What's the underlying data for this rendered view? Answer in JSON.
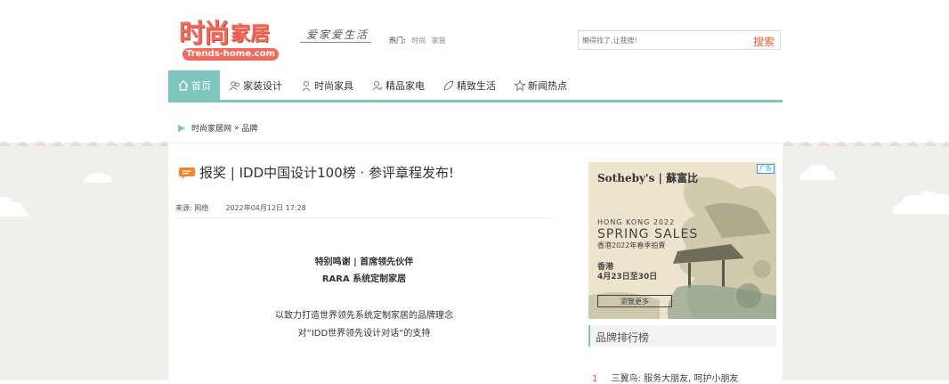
{
  "header": {
    "logo_main": "时尚",
    "logo_sub": "家居",
    "logo_domain": "Trends-home.com",
    "slogan": "爱家爱生活",
    "hot_label": "热门:",
    "hot_links": [
      "时尚",
      "家装"
    ],
    "search_placeholder": "懒得找了,让我搜!",
    "search_button": "搜索"
  },
  "nav": {
    "items": [
      {
        "label": "首页",
        "icon": "home-icon"
      },
      {
        "label": "家装设计",
        "icon": "people-icon"
      },
      {
        "label": "时尚家具",
        "icon": "person-icon"
      },
      {
        "label": "精品家电",
        "icon": "appliance-icon"
      },
      {
        "label": "精致生活",
        "icon": "leaf-icon"
      },
      {
        "label": "新闻热点",
        "icon": "star-icon"
      }
    ]
  },
  "breadcrumb": {
    "home": "时尚家居网",
    "sep": "»",
    "current": "品牌"
  },
  "article": {
    "title": "报奖 | IDD中国设计100榜 · 参评章程发布!",
    "source_label": "来源:",
    "source": "网络",
    "date": "2022年04月12日 17:28",
    "lines": [
      "特别鸣谢 | 首席领先伙伴",
      "RARA 系统定制家居",
      "以致力打造世界领先系统定制家居的品牌理念",
      "对“IDD世界领先设计对话”的支持"
    ]
  },
  "ad": {
    "badge": "广告",
    "brand": "Sotheby's | 蘇富比",
    "line1": "HONG KONG 2022",
    "line2": "SPRING SALES",
    "line3": "香港2022年春季拍賣",
    "line4": "香港",
    "line5": "4月23日至30日",
    "button": "瀏覽更多"
  },
  "sidebar": {
    "rank_title": "品牌排行榜",
    "rank_items": [
      {
        "num": "1",
        "text": "三翼鸟: 服务大朋友, 呵护小朋友"
      }
    ]
  },
  "colors": {
    "accent": "#7ec5be",
    "logo": "#f46a5a",
    "search": "#f05a40"
  }
}
